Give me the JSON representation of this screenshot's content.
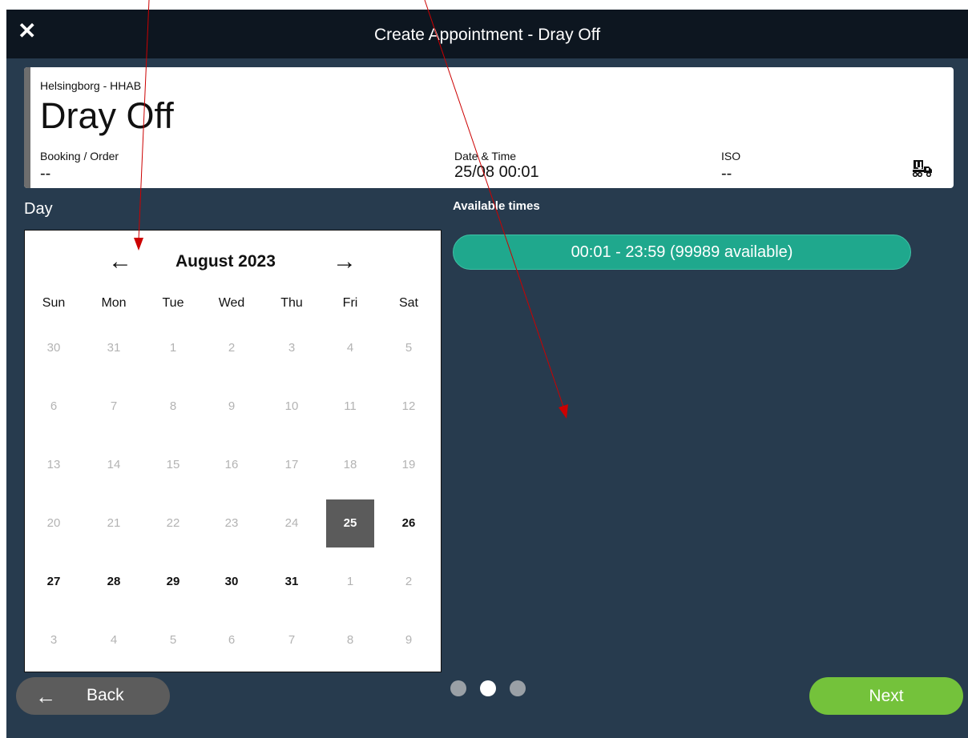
{
  "window": {
    "title": "Create Appointment - Dray Off",
    "close_icon": "close-icon"
  },
  "info": {
    "location": "Helsingborg - HHAB",
    "type": "Dray Off",
    "booking_label": "Booking / Order",
    "booking_value": "--",
    "datetime_label": "Date & Time",
    "datetime_value": "25/08 00:01",
    "iso_label": "ISO",
    "iso_value": "--",
    "icon": "truck-container-icon"
  },
  "day_label": "Day",
  "calendar": {
    "month_label": "August 2023",
    "prev": "←",
    "next": "→",
    "weekdays": [
      "Sun",
      "Mon",
      "Tue",
      "Wed",
      "Thu",
      "Fri",
      "Sat"
    ],
    "weeks": [
      [
        "30",
        "31",
        "1",
        "2",
        "3",
        "4",
        "5"
      ],
      [
        "6",
        "7",
        "8",
        "9",
        "10",
        "11",
        "12"
      ],
      [
        "13",
        "14",
        "15",
        "16",
        "17",
        "18",
        "19"
      ],
      [
        "20",
        "21",
        "22",
        "23",
        "24",
        "25",
        "26"
      ],
      [
        "27",
        "28",
        "29",
        "30",
        "31",
        "1",
        "2"
      ],
      [
        "3",
        "4",
        "5",
        "6",
        "7",
        "8",
        "9"
      ]
    ],
    "selected": "25"
  },
  "available": {
    "label": "Available times",
    "slots": [
      "00:01 - 23:59 (99989 available)"
    ]
  },
  "pager": {
    "pages": 3,
    "current": 2
  },
  "footer": {
    "back_arrow": "←",
    "back_label": "Back",
    "next_label": "Next"
  },
  "colors": {
    "background": "#273b4e",
    "titlebar": "#0d1620",
    "slot": "#1fa88d",
    "next": "#74c23b",
    "back": "#5c5c5c",
    "selected_day": "#5b5b5b",
    "annotation": "#cc0000"
  }
}
